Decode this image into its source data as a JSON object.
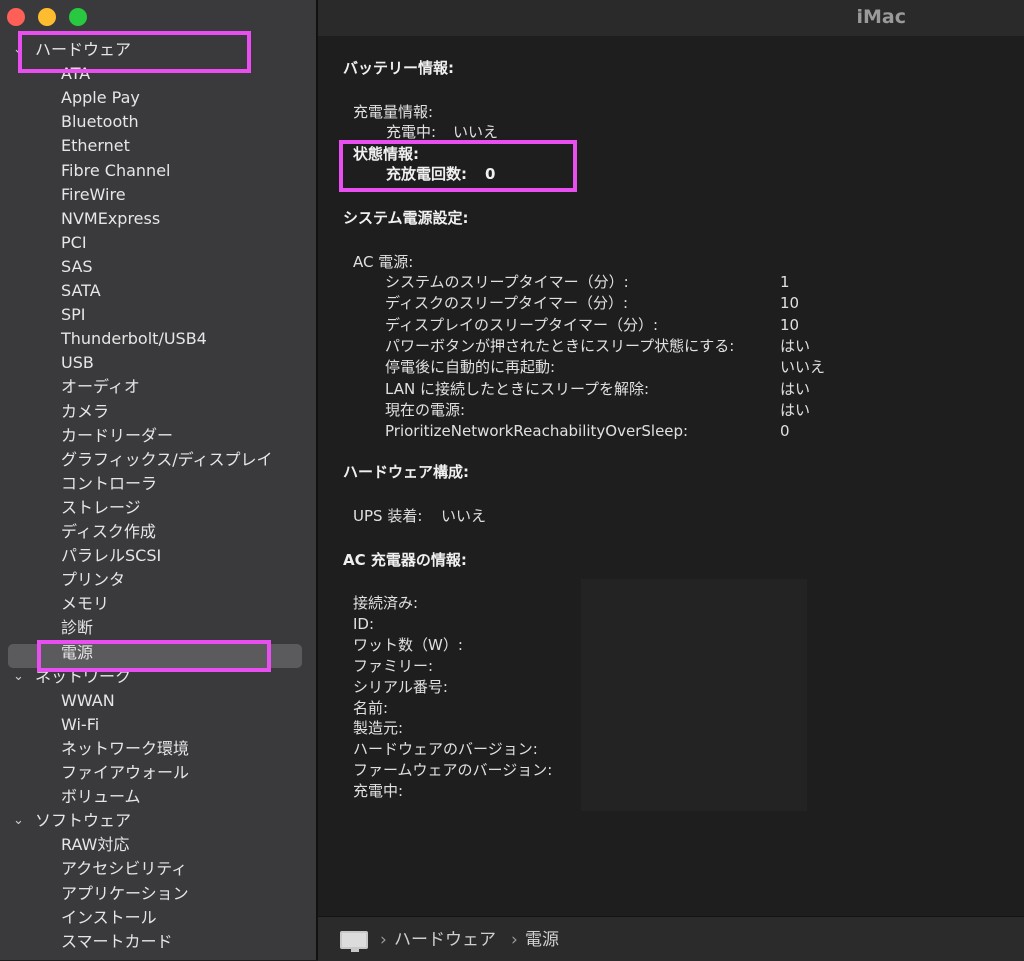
{
  "window": {
    "title": "iMac"
  },
  "sidebar": {
    "sections": [
      {
        "label": "ハードウェア",
        "items": [
          "ATA",
          "Apple Pay",
          "Bluetooth",
          "Ethernet",
          "Fibre Channel",
          "FireWire",
          "NVMExpress",
          "PCI",
          "SAS",
          "SATA",
          "SPI",
          "Thunderbolt/USB4",
          "USB",
          "オーディオ",
          "カメラ",
          "カードリーダー",
          "グラフィックス/ディスプレイ",
          "コントローラ",
          "ストレージ",
          "ディスク作成",
          "パラレルSCSI",
          "プリンタ",
          "メモリ",
          "診断",
          "電源"
        ]
      },
      {
        "label": "ネットワーク",
        "items": [
          "WWAN",
          "Wi-Fi",
          "ネットワーク環境",
          "ファイアウォール",
          "ボリューム"
        ]
      },
      {
        "label": "ソフトウェア",
        "items": [
          "RAW対応",
          "アクセシビリティ",
          "アプリケーション",
          "インストール",
          "スマートカード"
        ]
      }
    ],
    "selected": "電源"
  },
  "battery": {
    "heading": "バッテリー情報:",
    "charge_info_label": "充電量情報:",
    "charging_label": "充電中:",
    "charging_value": "いいえ",
    "health_label": "状態情報:",
    "cycle_label": "充放電回数:",
    "cycle_value": "0"
  },
  "power_settings": {
    "heading": "システム電源設定:",
    "ac_label": "AC 電源:",
    "rows": [
      {
        "label": "システムのスリープタイマー（分）:",
        "value": "1"
      },
      {
        "label": "ディスクのスリープタイマー（分）:",
        "value": "10"
      },
      {
        "label": "ディスプレイのスリープタイマー（分）:",
        "value": "10"
      },
      {
        "label": "パワーボタンが押されたときにスリープ状態にする:",
        "value": "はい"
      },
      {
        "label": "停電後に自動的に再起動:",
        "value": "いいえ"
      },
      {
        "label": "LAN に接続したときにスリープを解除:",
        "value": "はい"
      },
      {
        "label": "現在の電源:",
        "value": "はい"
      },
      {
        "label": "PrioritizeNetworkReachabilityOverSleep:",
        "value": "0"
      }
    ]
  },
  "hardware_config": {
    "heading": "ハードウェア構成:",
    "ups_label": "UPS 装着:",
    "ups_value": "いいえ"
  },
  "ac_charger": {
    "heading": "AC 充電器の情報:",
    "labels": [
      "接続済み:",
      "ID:",
      "ワット数（W）:",
      "ファミリー:",
      "シリアル番号:",
      "名前:",
      "製造元:",
      "ハードウェアのバージョン:",
      "ファームウェアのバージョン:",
      "充電中:"
    ]
  },
  "statusbar": {
    "icon": "computer-icon",
    "path": [
      "ハードウェア",
      "電源"
    ],
    "separator": "›"
  },
  "highlight_color": "#e84ef0"
}
